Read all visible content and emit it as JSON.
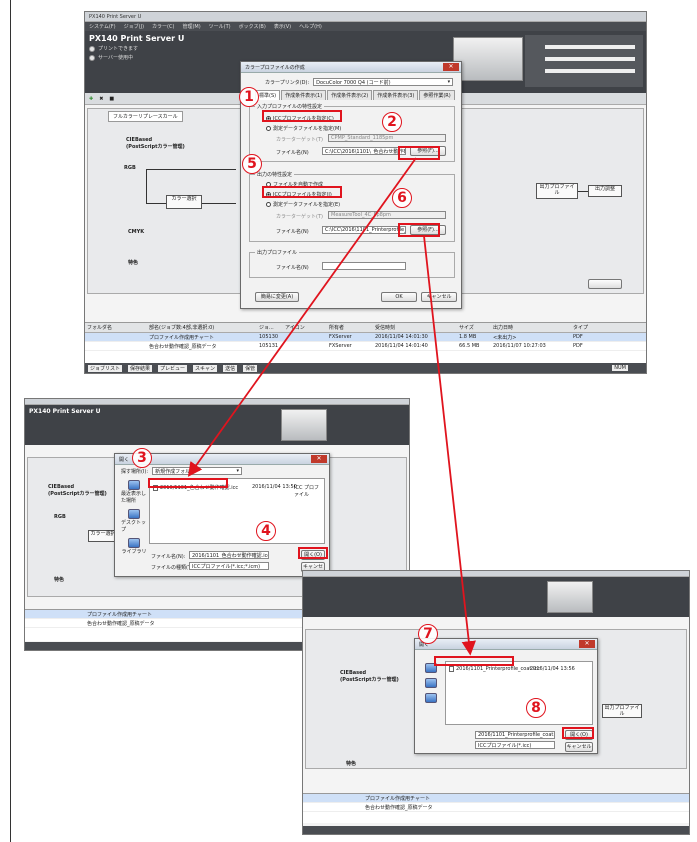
{
  "app": {
    "title": "PX140 Print Server U",
    "menu": [
      "システム(F)",
      "ジョブ(J)",
      "カラー(C)",
      "管理(M)",
      "ツール(T)",
      "ボックス(B)",
      "表示(V)",
      "ヘルプ(H)"
    ],
    "status_ok": "プリントできます",
    "status_server": "サーバー使用中",
    "tab_label": "フルカラーリプレースカール",
    "flow": {
      "cie_title": "CIEBased\n(PostScriptカラー管理)",
      "rgb": "RGB",
      "cmyk": "CMYK",
      "special": "特色",
      "color_select": "カラー選択",
      "output_profile": "出力プロファイル",
      "output_adjust": "出力調整"
    },
    "jobs": {
      "headers": [
        "フォルダ名",
        "部名(ジョブ数:4部,非選択:0)",
        "ジョ...",
        "アイコン",
        "所有者",
        "受信時刻",
        "サイズ",
        "出力日時",
        "タイプ"
      ],
      "rows": [
        [
          "",
          "プロファイル作成用チャート",
          "105130",
          "",
          "FXServer",
          "2016/11/04 14:01:30",
          "1.8 MB",
          "<未出力>",
          "PDF"
        ],
        [
          "",
          "色合わせ動作確認_原稿データ",
          "105131",
          "",
          "FXServer",
          "2016/11/04 14:01:40",
          "66.5 MB",
          "2016/11/07 10:27:03",
          "PDF"
        ]
      ]
    },
    "bottom": [
      "ジョブリスト",
      "保存結果",
      "プレビュー",
      "スキャン",
      "送信",
      "保管"
    ],
    "bottom_status": "NUM"
  },
  "main_dialog": {
    "title": "カラープロファイルの作成",
    "printer_label": "カラープリンタ(D):",
    "printer_value": "DocuColor 7000 Q4 (コード前)",
    "tabs": [
      "標準(S)",
      "作成条件表示(1)",
      "作成条件表示(2)",
      "作成条件表示(3)",
      "参照作業(R)"
    ],
    "group1_title": "入力プロファイルの特性設定",
    "opt_icc": "ICCプロファイルを指定(C)",
    "opt_measure": "測定データファイルを指定(M)",
    "chart_label": "カラーターゲット(T)",
    "chart_value": "CPMP_Standard_1185pm",
    "file_label": "ファイル名(N)",
    "file1_value": "C:\\ICC\\2016\\1101\\_色合わせ動作確認",
    "browse1": "参照(F)...",
    "group2_title": "出力の特性設定",
    "opt_auto": "ファイルを自動で作成",
    "opt_icc2": "ICCプロファイルを指定(I)",
    "opt_measure2": "測定データファイルを指定(E)",
    "chart2_value": "MeasureTool_4C_Fp8pm",
    "file2_value": "C:\\ICC\\2016\\1101_Printerprofile_coat.icc",
    "browse2": "参照(F)...",
    "group3_title": "出力プロファイル",
    "file3_label": "ファイル名(N)",
    "advanced": "簡易に変更(A)",
    "ok": "OK",
    "cancel": "キャンセル"
  },
  "open_dialog1": {
    "title": "開く",
    "look_in": "探す場所(I):",
    "folder": "新規作成フォルダー",
    "cols": [
      "名前",
      "更新日時",
      "種類"
    ],
    "file_name": "2016/1101_色合わせ動作確認.icc",
    "file_date": "2016/11/04 13:50",
    "file_type": "ICC プロファイル",
    "nav": [
      "最近表示した場所",
      "デスクトップ",
      "ライブラリ",
      "コンピューター",
      "ネットワーク"
    ],
    "filename_label": "ファイル名(N):",
    "filetype_label": "ファイルの種類(T):",
    "filename_value": "2016/1101_色合わせ動作確認.icc",
    "filetype_value": "ICCプロファイル(*.icc;*.icm)",
    "open": "開く(O)",
    "cancel": "キャンセル"
  },
  "open_dialog2": {
    "title": "開く",
    "file_name": "2016/1101_Printerprofile_coat.icc",
    "file_date": "2016/11/04 13:56",
    "file_type": "ICC プロファイル",
    "filename_value": "2016/1101_Printerprofile_coat.icc",
    "filetype_value": "ICCプロファイル(*.icc)",
    "open": "開く(O)",
    "cancel": "キャンセル"
  },
  "annotations": [
    "1",
    "2",
    "3",
    "4",
    "5",
    "6",
    "7",
    "8"
  ],
  "colors": {
    "annotation": "#e0141e",
    "menu": "#4a4d52",
    "header": "#3f4247"
  }
}
